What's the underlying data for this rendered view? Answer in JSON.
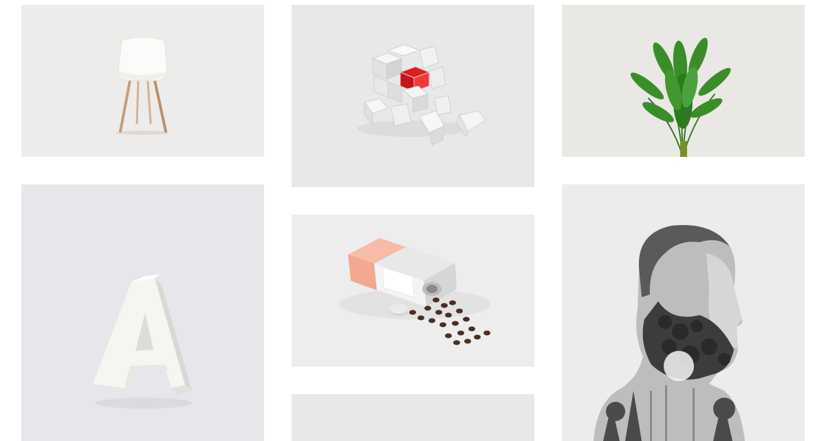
{
  "gallery": {
    "tiles": [
      {
        "id": "chair",
        "subject": "chair-image",
        "background": "#edecea",
        "accent": "#c49d7c"
      },
      {
        "id": "cubes",
        "subject": "cube-puzzle-image",
        "background": "#e8e8e9",
        "accent": "#e02020"
      },
      {
        "id": "palm",
        "subject": "palm-plant-image",
        "background": "#eae8e4",
        "accent": "#3a8e2a"
      },
      {
        "id": "letter",
        "subject": "letter-a-sculpture-image",
        "background": "#e6e7ea",
        "accent": "#f6f5f2"
      },
      {
        "id": "coffee",
        "subject": "coffee-tin-image",
        "background": "#ededed",
        "accent": "#f2a98f"
      },
      {
        "id": "portrait",
        "subject": "double-exposure-portrait-image",
        "background": "#ececec",
        "accent": "#5a5a5a"
      },
      {
        "id": "blank",
        "subject": "partial-image",
        "background": "#e7e8e7",
        "accent": "#e7e8e7"
      }
    ]
  }
}
